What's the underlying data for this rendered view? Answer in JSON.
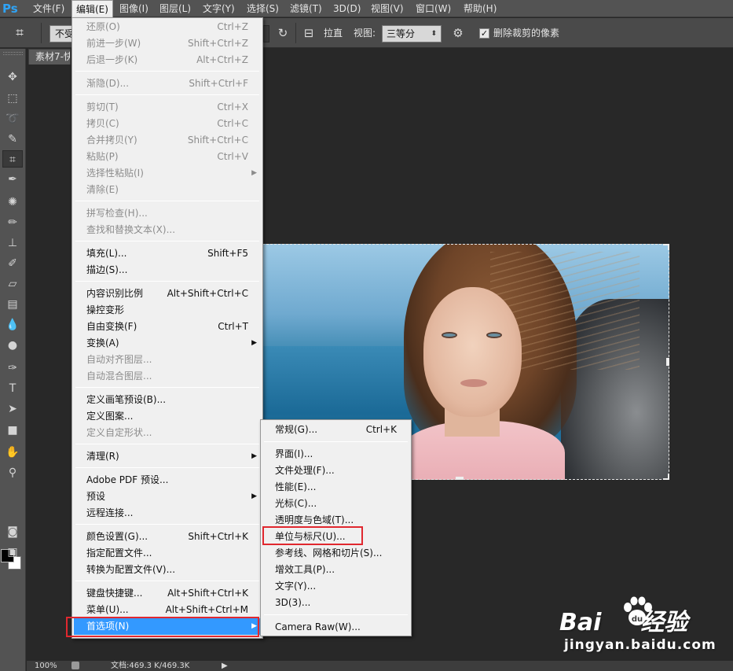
{
  "app": {
    "logo": "Ps"
  },
  "menubar": [
    {
      "label": "文件(F)"
    },
    {
      "label": "编辑(E)"
    },
    {
      "label": "图像(I)"
    },
    {
      "label": "图层(L)"
    },
    {
      "label": "文字(Y)"
    },
    {
      "label": "选择(S)"
    },
    {
      "label": "滤镜(T)"
    },
    {
      "label": "3D(D)"
    },
    {
      "label": "视图(V)"
    },
    {
      "label": "窗口(W)"
    },
    {
      "label": "帮助(H)"
    }
  ],
  "options": {
    "ratio_value": "不受",
    "straighten_label": "拉直",
    "view_label": "视图:",
    "view_value": "三等分",
    "delete_cropped_label": "删除裁剪的像素",
    "delete_cropped_checked": true
  },
  "document": {
    "tab_title": "素材7-快",
    "zoom": "100%",
    "doc_info": "文档:469.3 K/469.3K"
  },
  "edit_menu": {
    "groups": [
      [
        {
          "label": "还原(O)",
          "shortcut": "Ctrl+Z",
          "disabled": true
        },
        {
          "label": "前进一步(W)",
          "shortcut": "Shift+Ctrl+Z",
          "disabled": true
        },
        {
          "label": "后退一步(K)",
          "shortcut": "Alt+Ctrl+Z",
          "disabled": true
        }
      ],
      [
        {
          "label": "渐隐(D)...",
          "shortcut": "Shift+Ctrl+F",
          "disabled": true
        }
      ],
      [
        {
          "label": "剪切(T)",
          "shortcut": "Ctrl+X",
          "disabled": true
        },
        {
          "label": "拷贝(C)",
          "shortcut": "Ctrl+C",
          "disabled": true
        },
        {
          "label": "合并拷贝(Y)",
          "shortcut": "Shift+Ctrl+C",
          "disabled": true
        },
        {
          "label": "粘贴(P)",
          "shortcut": "Ctrl+V",
          "disabled": true
        },
        {
          "label": "选择性粘贴(I)",
          "shortcut": "",
          "disabled": true,
          "submenu": true
        },
        {
          "label": "清除(E)",
          "shortcut": "",
          "disabled": true
        }
      ],
      [
        {
          "label": "拼写检查(H)...",
          "shortcut": "",
          "disabled": true
        },
        {
          "label": "查找和替换文本(X)...",
          "shortcut": "",
          "disabled": true
        }
      ],
      [
        {
          "label": "填充(L)...",
          "shortcut": "Shift+F5",
          "disabled": false
        },
        {
          "label": "描边(S)...",
          "shortcut": "",
          "disabled": false
        }
      ],
      [
        {
          "label": "内容识别比例",
          "shortcut": "Alt+Shift+Ctrl+C",
          "disabled": false
        },
        {
          "label": "操控变形",
          "shortcut": "",
          "disabled": false
        },
        {
          "label": "自由变换(F)",
          "shortcut": "Ctrl+T",
          "disabled": false
        },
        {
          "label": "变换(A)",
          "shortcut": "",
          "disabled": false,
          "submenu": true
        },
        {
          "label": "自动对齐图层...",
          "shortcut": "",
          "disabled": true
        },
        {
          "label": "自动混合图层...",
          "shortcut": "",
          "disabled": true
        }
      ],
      [
        {
          "label": "定义画笔预设(B)...",
          "shortcut": "",
          "disabled": false
        },
        {
          "label": "定义图案...",
          "shortcut": "",
          "disabled": false
        },
        {
          "label": "定义自定形状...",
          "shortcut": "",
          "disabled": true
        }
      ],
      [
        {
          "label": "清理(R)",
          "shortcut": "",
          "disabled": false,
          "submenu": true
        }
      ],
      [
        {
          "label": "Adobe PDF 预设...",
          "shortcut": "",
          "disabled": false
        },
        {
          "label": "预设",
          "shortcut": "",
          "disabled": false,
          "submenu": true
        },
        {
          "label": "远程连接...",
          "shortcut": "",
          "disabled": false
        }
      ],
      [
        {
          "label": "颜色设置(G)...",
          "shortcut": "Shift+Ctrl+K",
          "disabled": false
        },
        {
          "label": "指定配置文件...",
          "shortcut": "",
          "disabled": false
        },
        {
          "label": "转换为配置文件(V)...",
          "shortcut": "",
          "disabled": false
        }
      ],
      [
        {
          "label": "键盘快捷键...",
          "shortcut": "Alt+Shift+Ctrl+K",
          "disabled": false
        },
        {
          "label": "菜单(U)...",
          "shortcut": "Alt+Shift+Ctrl+M",
          "disabled": false
        },
        {
          "label": "首选项(N)",
          "shortcut": "",
          "disabled": false,
          "submenu": true,
          "highlight": true
        }
      ]
    ]
  },
  "prefs_menu": {
    "groups": [
      [
        {
          "label": "常规(G)...",
          "shortcut": "Ctrl+K"
        }
      ],
      [
        {
          "label": "界面(I)...",
          "shortcut": ""
        },
        {
          "label": "文件处理(F)...",
          "shortcut": ""
        },
        {
          "label": "性能(E)...",
          "shortcut": ""
        },
        {
          "label": "光标(C)...",
          "shortcut": ""
        },
        {
          "label": "透明度与色域(T)...",
          "shortcut": ""
        },
        {
          "label": "单位与标尺(U)...",
          "shortcut": "",
          "boxed": true
        },
        {
          "label": "参考线、网格和切片(S)...",
          "shortcut": ""
        },
        {
          "label": "增效工具(P)...",
          "shortcut": ""
        },
        {
          "label": "文字(Y)...",
          "shortcut": ""
        },
        {
          "label": "3D(3)...",
          "shortcut": ""
        }
      ],
      [
        {
          "label": "Camera Raw(W)...",
          "shortcut": ""
        }
      ]
    ]
  },
  "tools": [
    {
      "icon": "move-icon",
      "glyph": "✥"
    },
    {
      "icon": "marquee-icon",
      "glyph": "⬚"
    },
    {
      "icon": "lasso-icon",
      "glyph": "➰"
    },
    {
      "icon": "quick-select-icon",
      "glyph": "✎"
    },
    {
      "icon": "crop-icon",
      "glyph": "⌗",
      "selected": true
    },
    {
      "icon": "eyedropper-icon",
      "glyph": "✒"
    },
    {
      "icon": "healing-icon",
      "glyph": "✺"
    },
    {
      "icon": "brush-icon",
      "glyph": "✏"
    },
    {
      "icon": "stamp-icon",
      "glyph": "⊥"
    },
    {
      "icon": "history-brush-icon",
      "glyph": "✐"
    },
    {
      "icon": "eraser-icon",
      "glyph": "▱"
    },
    {
      "icon": "gradient-icon",
      "glyph": "▤"
    },
    {
      "icon": "blur-icon",
      "glyph": "💧"
    },
    {
      "icon": "dodge-icon",
      "glyph": "●"
    },
    {
      "icon": "pen-icon",
      "glyph": "✑"
    },
    {
      "icon": "type-icon",
      "glyph": "T"
    },
    {
      "icon": "path-select-icon",
      "glyph": "➤"
    },
    {
      "icon": "shape-icon",
      "glyph": "■"
    },
    {
      "icon": "hand-icon",
      "glyph": "✋"
    },
    {
      "icon": "zoom-icon",
      "glyph": "⚲"
    },
    {
      "icon": "quick-mask-icon",
      "glyph": "◙"
    },
    {
      "icon": "screen-mode-icon",
      "glyph": "▣"
    }
  ],
  "watermark": {
    "brand": "Bai",
    "brand2": "经验",
    "url": "jingyan.baidu.com"
  }
}
